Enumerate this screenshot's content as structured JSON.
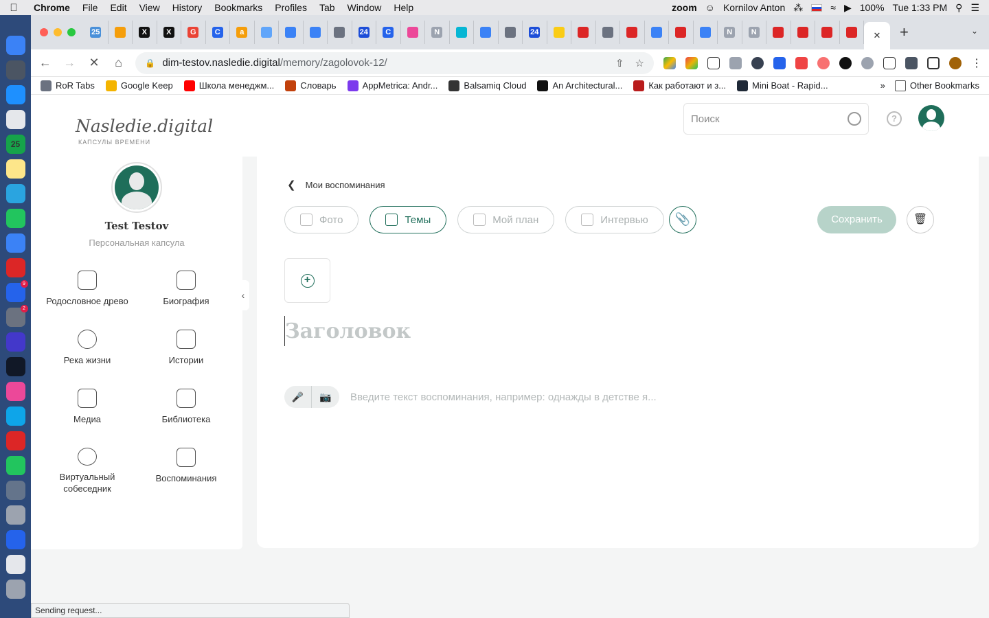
{
  "menubar": {
    "app_name": "Chrome",
    "items": [
      "File",
      "Edit",
      "View",
      "History",
      "Bookmarks",
      "Profiles",
      "Tab",
      "Window",
      "Help"
    ],
    "zoom_label": "zoom",
    "user": "Kornilov Anton",
    "battery": "100%",
    "clock": "Tue 1:33 PM"
  },
  "dock": {
    "calendar_day": "25",
    "appstore_badge": "9",
    "prefs_badge": "2",
    "colors": [
      "#3b82f6",
      "#4b5563",
      "#1e90ff",
      "#e5e7eb",
      "#16a34a",
      "#fde68a",
      "#2aa4e0",
      "#22c55e",
      "#3b82f6",
      "#dc2626",
      "#2563eb",
      "#6b7280",
      "#4338ca",
      "#111827",
      "#ec4899",
      "#0ea5e9",
      "#dc2626",
      "#22c55e",
      "#64748b",
      "#9ca3af",
      "#2563eb",
      "#e5e7eb",
      "#9ca3af"
    ]
  },
  "tabs": {
    "favicons": [
      {
        "label": "25",
        "color": "#4a90d9"
      },
      {
        "label": "",
        "color": "#f59e0b"
      },
      {
        "label": "X",
        "color": "#111111"
      },
      {
        "label": "X",
        "color": "#111111"
      },
      {
        "label": "G",
        "color": "#ea4335"
      },
      {
        "label": "C",
        "color": "#2563eb"
      },
      {
        "label": "a",
        "color": "#f59e0b"
      },
      {
        "label": "",
        "color": "#60a5fa"
      },
      {
        "label": "",
        "color": "#3b82f6"
      },
      {
        "label": "",
        "color": "#3b82f6"
      },
      {
        "label": "",
        "color": "#6b7280"
      },
      {
        "label": "24",
        "color": "#1d4ed8"
      },
      {
        "label": "C",
        "color": "#2563eb"
      },
      {
        "label": "",
        "color": "#ec4899"
      },
      {
        "label": "N",
        "color": "#9ca3af"
      },
      {
        "label": "",
        "color": "#06b6d4"
      },
      {
        "label": "",
        "color": "#3b82f6"
      },
      {
        "label": "",
        "color": "#6b7280"
      },
      {
        "label": "24",
        "color": "#1d4ed8"
      },
      {
        "label": "",
        "color": "#facc15"
      },
      {
        "label": "",
        "color": "#dc2626"
      },
      {
        "label": "",
        "color": "#6b7280"
      },
      {
        "label": "",
        "color": "#dc2626"
      },
      {
        "label": "",
        "color": "#3b82f6"
      },
      {
        "label": "",
        "color": "#dc2626"
      },
      {
        "label": "",
        "color": "#3b82f6"
      },
      {
        "label": "N",
        "color": "#9ca3af"
      },
      {
        "label": "N",
        "color": "#9ca3af"
      },
      {
        "label": "",
        "color": "#dc2626"
      },
      {
        "label": "",
        "color": "#dc2626"
      },
      {
        "label": "",
        "color": "#dc2626"
      },
      {
        "label": "",
        "color": "#dc2626"
      }
    ],
    "active_close": "✕",
    "new_tab": "+"
  },
  "toolbar": {
    "url_host": "dim-testov.nasledie.digital",
    "url_path": "/memory/zagolovok-12/"
  },
  "bookmarks": {
    "items": [
      {
        "label": "RoR Tabs",
        "color": "#6b7280"
      },
      {
        "label": "Google Keep",
        "color": "#f4b400"
      },
      {
        "label": "Школа менеджм...",
        "color": "#ff0000"
      },
      {
        "label": "Словарь",
        "color": "#c2410c"
      },
      {
        "label": "AppMetrica: Andr...",
        "color": "#7c3aed"
      },
      {
        "label": "Balsamiq Cloud",
        "color": "#333333"
      },
      {
        "label": "An Architectural...",
        "color": "#111111"
      },
      {
        "label": "Как работают и з...",
        "color": "#b91c1c"
      },
      {
        "label": "Mini Boat - Rapid...",
        "color": "#1f2937"
      }
    ],
    "more": "»",
    "other": "Other Bookmarks"
  },
  "site": {
    "logo": "Nasledie.digital",
    "logo_sub": "КАПСУЛЫ ВРЕМЕНИ",
    "search_placeholder": "Поиск",
    "help": "?"
  },
  "sidebar": {
    "name": "Test Testov",
    "subtitle": "Персональная капсула",
    "items": [
      {
        "label": "Родословное древо",
        "icon": "tree-icon"
      },
      {
        "label": "Биография",
        "icon": "feather-icon"
      },
      {
        "label": "Река жизни",
        "icon": "clock-icon"
      },
      {
        "label": "Истории",
        "icon": "book-icon"
      },
      {
        "label": "Медиа",
        "icon": "images-icon"
      },
      {
        "label": "Библиотека",
        "icon": "cloud-gear-icon"
      },
      {
        "label": "Виртуальный собеседник",
        "icon": "chat-bot-icon"
      },
      {
        "label": "Воспоминания",
        "icon": "notebook-icon"
      }
    ],
    "collapse": "‹"
  },
  "editor": {
    "back_label": "Мои воспоминания",
    "tabs": [
      "Фото",
      "Темы",
      "Мой план",
      "Интервью"
    ],
    "active_tab": "Темы",
    "save_label": "Сохранить",
    "title_placeholder": "Заголовок",
    "body_placeholder": "Введите текст воспоминания, например: однажды в детстве я..."
  },
  "status": {
    "text": "Sending request..."
  },
  "colors": {
    "accent": "#1f6e5a",
    "save_disabled": "#b7d3c9"
  }
}
